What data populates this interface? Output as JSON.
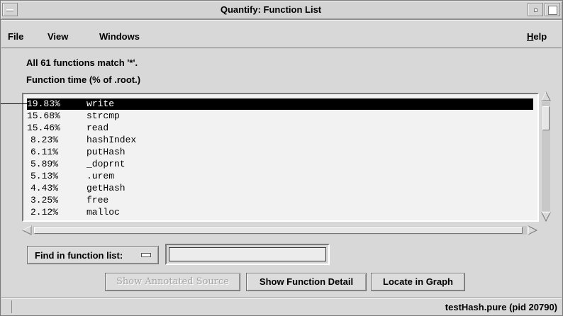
{
  "window": {
    "title": "Quantify: Function List"
  },
  "menubar": {
    "file": "File",
    "view": "View",
    "windows": "Windows",
    "help_first": "H",
    "help_rest": "elp"
  },
  "info": {
    "match_text": "All 61 functions match '*'.",
    "metric_text": "Function time (% of .root.)"
  },
  "function_list": {
    "selected_index": 0,
    "rows": [
      {
        "pct": "19.83%",
        "name": "write"
      },
      {
        "pct": "15.68%",
        "name": "strcmp"
      },
      {
        "pct": "15.46%",
        "name": "read"
      },
      {
        "pct": "8.23%",
        "name": "hashIndex"
      },
      {
        "pct": "6.11%",
        "name": "putHash"
      },
      {
        "pct": "5.89%",
        "name": "_doprnt"
      },
      {
        "pct": "5.13%",
        "name": ".urem"
      },
      {
        "pct": "4.43%",
        "name": "getHash"
      },
      {
        "pct": "3.25%",
        "name": "free"
      },
      {
        "pct": "2.12%",
        "name": "malloc"
      }
    ]
  },
  "find": {
    "label": "Find in function list:",
    "value": ""
  },
  "buttons": {
    "annotated_source": "Show Annotated Source",
    "function_detail": "Show Function Detail",
    "locate_graph": "Locate in Graph"
  },
  "status": {
    "text": "testHash.pure (pid 20790)"
  },
  "icons": {
    "window_menu": "window-menu-icon",
    "minimize": "minimize-icon",
    "maximize": "maximize-icon",
    "find_option": "option-menu-icon"
  }
}
